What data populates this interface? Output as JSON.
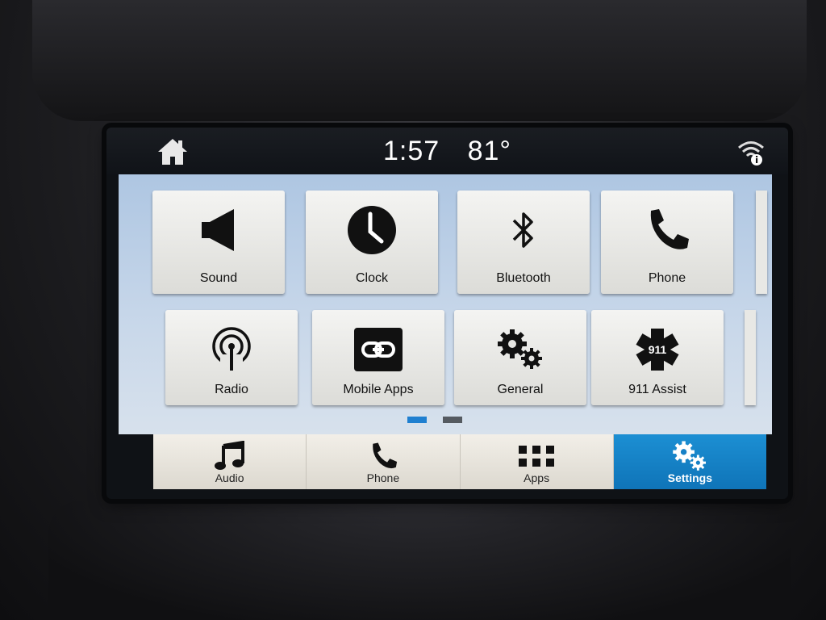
{
  "status_bar": {
    "time": "1:57",
    "temperature": "81°",
    "icons": {
      "home": "home-icon",
      "wifi": "wifi-info-icon"
    }
  },
  "settings_grid": {
    "tiles": [
      {
        "label": "Sound",
        "icon": "speaker-icon"
      },
      {
        "label": "Clock",
        "icon": "clock-icon"
      },
      {
        "label": "Bluetooth",
        "icon": "bluetooth-icon"
      },
      {
        "label": "Phone",
        "icon": "phone-icon"
      },
      {
        "label": "Radio",
        "icon": "radio-icon"
      },
      {
        "label": "Mobile Apps",
        "icon": "link-icon"
      },
      {
        "label": "General",
        "icon": "gears-icon"
      },
      {
        "label": "911 Assist",
        "icon": "star-of-life-icon"
      }
    ],
    "star_badge": "911",
    "pages": 2,
    "current_page": 1
  },
  "bottom_nav": {
    "items": [
      {
        "label": "Audio",
        "icon": "music-note-icon"
      },
      {
        "label": "Phone",
        "icon": "phone-icon"
      },
      {
        "label": "Apps",
        "icon": "apps-grid-icon"
      },
      {
        "label": "Settings",
        "icon": "gears-icon"
      }
    ],
    "active_index": 3
  },
  "colors": {
    "accent": "#1c8fd3",
    "panel_bg": "#c9d8ea",
    "page_dot_active": "#1f7fd0",
    "page_dot_inactive": "#555a60"
  }
}
